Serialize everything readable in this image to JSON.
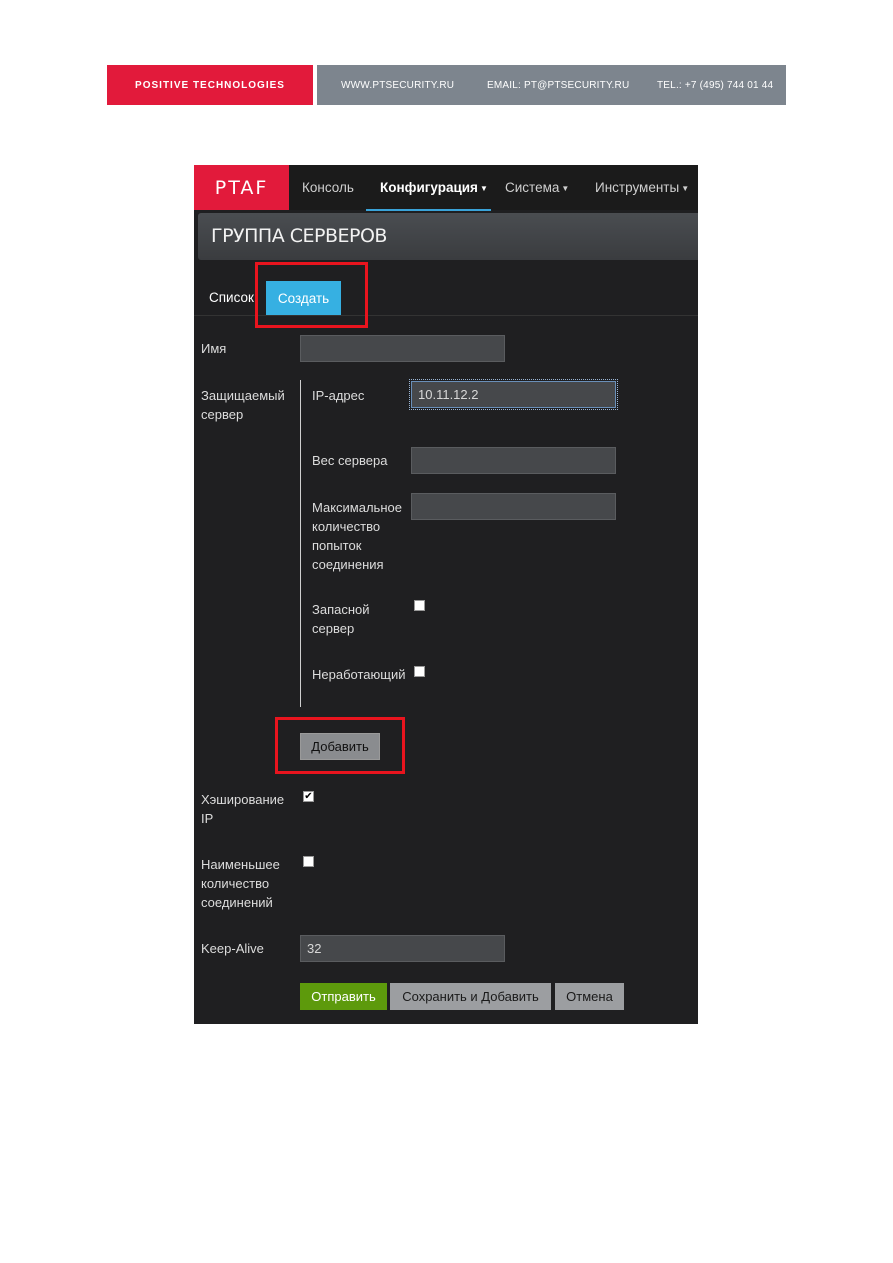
{
  "banner": {
    "company": "POSITIVE TECHNOLOGIES",
    "website": "WWW.PTSECURITY.RU",
    "email": "EMAIL: PT@PTSECURITY.RU",
    "phone": "TEL.: +7 (495) 744 01 44"
  },
  "navbar": {
    "logo": "PTAF",
    "items": [
      {
        "label": "Консоль"
      },
      {
        "label": "Конфигурация"
      },
      {
        "label": "Система"
      },
      {
        "label": "Инструменты"
      }
    ],
    "caret": "▼"
  },
  "page": {
    "title": "ГРУППА СЕРВЕРОВ"
  },
  "tabs": {
    "list": "Список",
    "create": "Создать"
  },
  "form": {
    "name_label": "Имя",
    "name_value": "",
    "protected_server_label": "Защищаемый сервер",
    "ip_label": "IP-адрес",
    "ip_value": "10.11.12.2",
    "weight_label": "Вес сервера",
    "weight_value": "",
    "max_attempts_label": "Максимальное количество попыток соединения",
    "max_attempts_value": "",
    "backup_label": "Запасной сервер",
    "backup_checked": false,
    "down_label": "Неработающий",
    "down_checked": false,
    "add_button": "Добавить",
    "ip_hash_label": "Хэширование IP",
    "ip_hash_checked": true,
    "least_conn_label": "Наименьшее количество соединений",
    "least_conn_checked": false,
    "keepalive_label": "Keep-Alive",
    "keepalive_value": "32",
    "submit_button": "Отправить",
    "save_add_button": "Сохранить и Добавить",
    "cancel_button": "Отмена",
    "check_mark": "✔"
  },
  "colors": {
    "brand_red": "#e21a3b",
    "accent_blue": "#36b0e2",
    "submit_green": "#5d9a0c",
    "highlight_red": "#e8141e"
  }
}
